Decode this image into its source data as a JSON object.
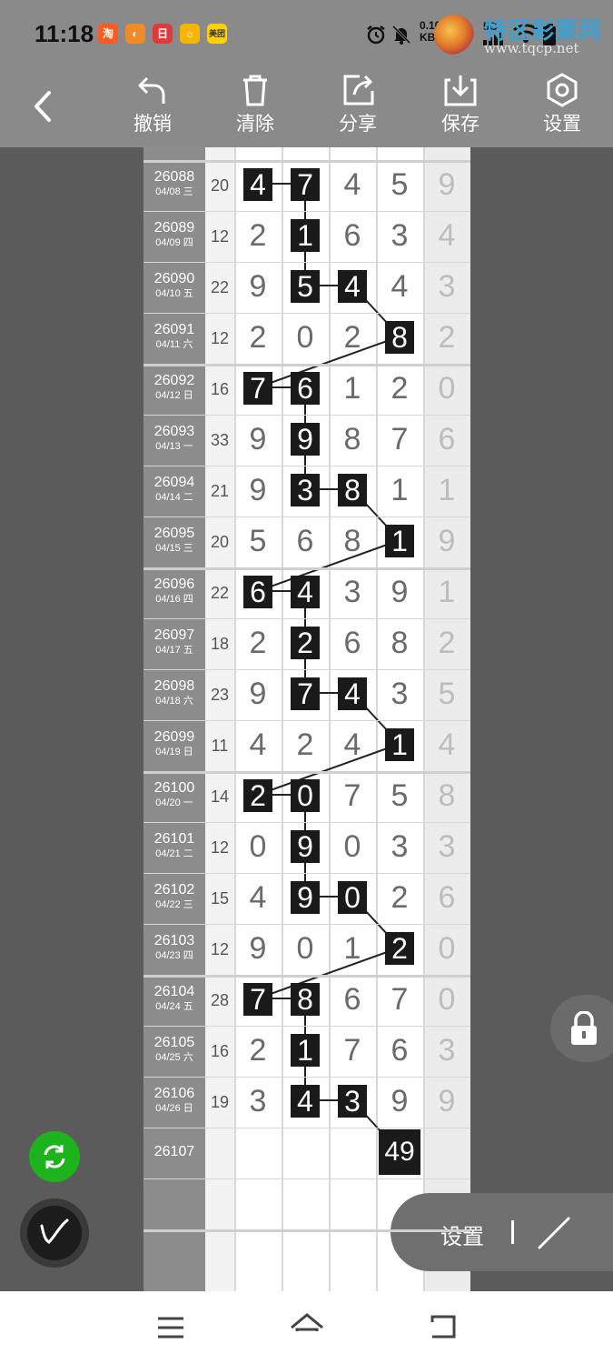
{
  "status": {
    "time": "11:18",
    "apps": [
      {
        "name": "淘",
        "color": "#ff5a1f"
      },
      {
        "name": "◐",
        "color": "#f08b2a"
      },
      {
        "name": "日",
        "color": "#e23a3a"
      },
      {
        "name": "☼",
        "color": "#f4b400"
      },
      {
        "name": "美团",
        "color": "#ffd100"
      }
    ],
    "net_speed": "0.10",
    "net_unit": "KB/s",
    "signal_label": "5G"
  },
  "watermark": {
    "text": "特区彩票网",
    "url": "www.tqcp.net"
  },
  "toolbar": {
    "undo": "撤销",
    "clear": "清除",
    "share": "分享",
    "save": "保存",
    "settings": "设置"
  },
  "rows": [
    {
      "id": "26088",
      "date": "04/08 三",
      "sum": "20",
      "d": [
        "4",
        "7",
        "4",
        "5"
      ],
      "last": "9"
    },
    {
      "id": "26089",
      "date": "04/09 四",
      "sum": "12",
      "d": [
        "2",
        "1",
        "6",
        "3"
      ],
      "last": "4"
    },
    {
      "id": "26090",
      "date": "04/10 五",
      "sum": "22",
      "d": [
        "9",
        "5",
        "4",
        "4"
      ],
      "last": "3"
    },
    {
      "id": "26091",
      "date": "04/11 六",
      "sum": "12",
      "d": [
        "2",
        "0",
        "2",
        "8"
      ],
      "last": "2"
    },
    {
      "id": "26092",
      "date": "04/12 日",
      "sum": "16",
      "d": [
        "7",
        "6",
        "1",
        "2"
      ],
      "last": "0"
    },
    {
      "id": "26093",
      "date": "04/13 一",
      "sum": "33",
      "d": [
        "9",
        "9",
        "8",
        "7"
      ],
      "last": "6"
    },
    {
      "id": "26094",
      "date": "04/14 二",
      "sum": "21",
      "d": [
        "9",
        "3",
        "8",
        "1"
      ],
      "last": "1"
    },
    {
      "id": "26095",
      "date": "04/15 三",
      "sum": "20",
      "d": [
        "5",
        "6",
        "8",
        "1"
      ],
      "last": "9"
    },
    {
      "id": "26096",
      "date": "04/16 四",
      "sum": "22",
      "d": [
        "6",
        "4",
        "3",
        "9"
      ],
      "last": "1"
    },
    {
      "id": "26097",
      "date": "04/17 五",
      "sum": "18",
      "d": [
        "2",
        "2",
        "6",
        "8"
      ],
      "last": "2"
    },
    {
      "id": "26098",
      "date": "04/18 六",
      "sum": "23",
      "d": [
        "9",
        "7",
        "4",
        "3"
      ],
      "last": "5"
    },
    {
      "id": "26099",
      "date": "04/19 日",
      "sum": "11",
      "d": [
        "4",
        "2",
        "4",
        "1"
      ],
      "last": "4"
    },
    {
      "id": "26100",
      "date": "04/20 一",
      "sum": "14",
      "d": [
        "2",
        "0",
        "7",
        "5"
      ],
      "last": "8"
    },
    {
      "id": "26101",
      "date": "04/21 二",
      "sum": "12",
      "d": [
        "0",
        "9",
        "0",
        "3"
      ],
      "last": "3"
    },
    {
      "id": "26102",
      "date": "04/22 三",
      "sum": "15",
      "d": [
        "4",
        "9",
        "0",
        "2"
      ],
      "last": "6"
    },
    {
      "id": "26103",
      "date": "04/23 四",
      "sum": "12",
      "d": [
        "9",
        "0",
        "1",
        "2"
      ],
      "last": "0"
    },
    {
      "id": "26104",
      "date": "04/24 五",
      "sum": "28",
      "d": [
        "7",
        "8",
        "6",
        "7"
      ],
      "last": "0"
    },
    {
      "id": "26105",
      "date": "04/25 六",
      "sum": "16",
      "d": [
        "2",
        "1",
        "7",
        "6"
      ],
      "last": "3"
    },
    {
      "id": "26106",
      "date": "04/26 日",
      "sum": "19",
      "d": [
        "3",
        "4",
        "3",
        "9"
      ],
      "last": "9"
    },
    {
      "id": "26107",
      "date": "",
      "sum": "",
      "d": [
        "",
        "",
        "",
        "49"
      ],
      "last": ""
    }
  ],
  "highlights": [
    [
      0,
      1
    ],
    [
      1
    ],
    [
      1,
      2
    ],
    [
      3
    ],
    [
      0,
      1
    ],
    [
      1
    ],
    [
      1,
      2
    ],
    [
      3
    ],
    [
      0,
      1
    ],
    [
      1
    ],
    [
      1,
      2
    ],
    [
      3
    ],
    [
      0,
      1
    ],
    [
      1
    ],
    [
      1,
      2
    ],
    [
      3
    ],
    [
      0,
      1
    ],
    [
      1
    ],
    [
      1,
      2
    ],
    [
      3
    ]
  ],
  "floating": {
    "settings_label": "设置"
  }
}
